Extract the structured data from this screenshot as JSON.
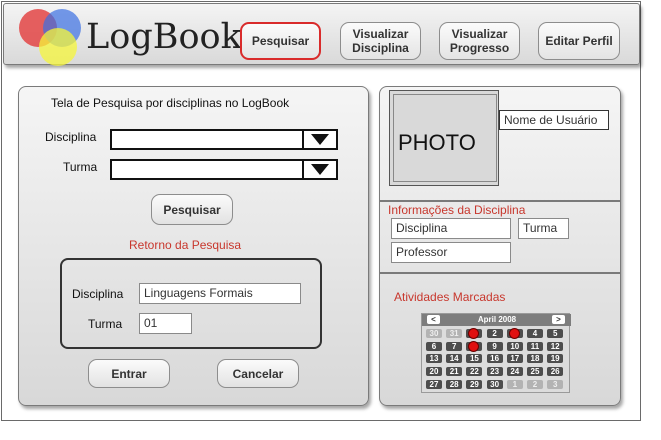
{
  "app": {
    "logo_text": "LogBook"
  },
  "nav": [
    {
      "label": "Pesquisar",
      "active": true
    },
    {
      "label": "Visualizar Disciplina",
      "active": false
    },
    {
      "label": "Visualizar Progresso",
      "active": false
    },
    {
      "label": "Editar Perfil",
      "active": false
    }
  ],
  "search": {
    "title": "Tela de Pesquisa por disciplinas no LogBook",
    "disciplina_label": "Disciplina",
    "disciplina_value": "",
    "turma_label": "Turma",
    "turma_value": "",
    "search_button": "Pesquisar",
    "result_title": "Retorno da Pesquisa",
    "result": {
      "disciplina_label": "Disciplina",
      "disciplina_value": "Linguagens Formais",
      "turma_label": "Turma",
      "turma_value": "01"
    },
    "enter_button": "Entrar",
    "cancel_button": "Cancelar"
  },
  "profile": {
    "photo_text": "PHOTO",
    "username": "Nome de Usuário",
    "info_title": "Informações da Disciplina",
    "disciplina": "Disciplina",
    "turma": "Turma",
    "professor": "Professor",
    "activities_title": "Atividades Marcadas"
  },
  "calendar": {
    "month": "April 2008",
    "prev_icon": "chevron-left-icon",
    "next_icon": "chevron-right-icon",
    "prev_glyph": "<",
    "next_glyph": ">",
    "weeks": [
      [
        "30",
        "31",
        "1",
        "2",
        "3",
        "4",
        "5"
      ],
      [
        "6",
        "7",
        "8",
        "9",
        "10",
        "11",
        "12"
      ],
      [
        "13",
        "14",
        "15",
        "16",
        "17",
        "18",
        "19"
      ],
      [
        "20",
        "21",
        "22",
        "23",
        "24",
        "25",
        "26"
      ],
      [
        "27",
        "28",
        "29",
        "30",
        "1",
        "2",
        "3"
      ]
    ],
    "dim_cells": [
      [
        0,
        0
      ],
      [
        0,
        1
      ],
      [
        4,
        4
      ],
      [
        4,
        5
      ],
      [
        4,
        6
      ]
    ],
    "marked_cells": [
      [
        0,
        2
      ],
      [
        0,
        4
      ],
      [
        1,
        2
      ]
    ],
    "mark_color": "#e01010"
  },
  "colors": {
    "accent_red": "#d92b2b",
    "section_title": "#c8372d"
  }
}
